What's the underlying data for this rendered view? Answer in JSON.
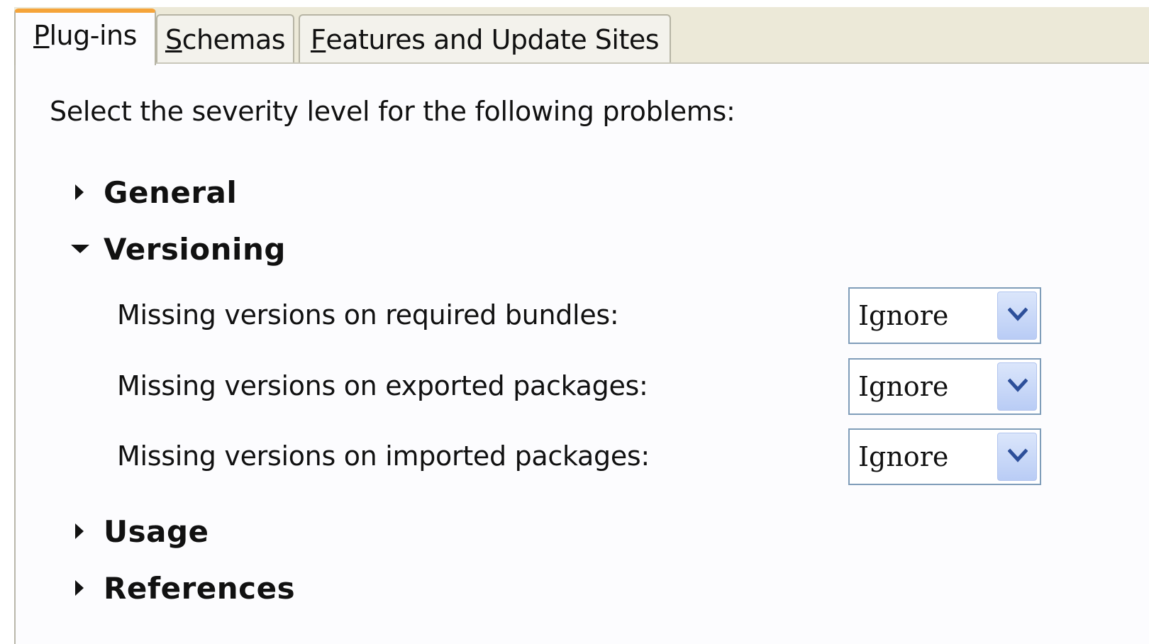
{
  "tabs": [
    {
      "label_underlined": "P",
      "label_rest": "lug-ins",
      "active": true
    },
    {
      "label_underlined": "S",
      "label_rest": "chemas",
      "active": false
    },
    {
      "label_underlined": "F",
      "label_rest": "eatures and Update Sites",
      "active": false
    }
  ],
  "intro_text": "Select the severity level for the following problems:",
  "sections": {
    "general": {
      "title": "General",
      "expanded": false
    },
    "versioning": {
      "title": "Versioning",
      "expanded": true,
      "rows": [
        {
          "label": "Missing versions on required bundles:",
          "value": "Ignore"
        },
        {
          "label": "Missing versions on exported packages:",
          "value": "Ignore"
        },
        {
          "label": "Missing versions on imported packages:",
          "value": "Ignore"
        }
      ]
    },
    "usage": {
      "title": "Usage",
      "expanded": false
    },
    "references": {
      "title": "References",
      "expanded": false
    }
  },
  "icons": {
    "collapsed": "triangle-right-icon",
    "expanded": "triangle-down-icon",
    "dropdown": "chevron-down-icon"
  },
  "colors": {
    "active_tab_accent": "#f5a43a",
    "combo_border": "#7f9db9",
    "combo_button": "#c6d6f8"
  }
}
